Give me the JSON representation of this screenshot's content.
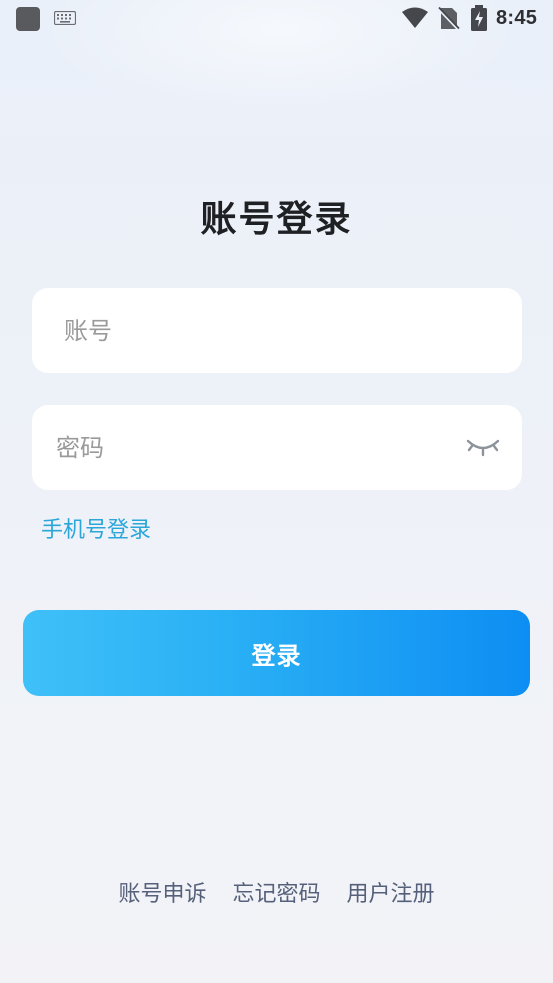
{
  "status_bar": {
    "time": "8:45",
    "icons": [
      "app-icon",
      "keyboard-icon",
      "wifi-icon",
      "no-sim-icon",
      "battery-charging-icon"
    ]
  },
  "page": {
    "title": "账号登录"
  },
  "form": {
    "account_placeholder": "账号",
    "account_value": "",
    "password_placeholder": "密码",
    "password_value": "",
    "password_toggle_icon": "eye-closed-icon"
  },
  "links": {
    "phone_login": "手机号登录"
  },
  "login_button": {
    "label": "登录",
    "gradient_start": "#3fc0f8",
    "gradient_end": "#0d8ef3"
  },
  "footer": {
    "appeal": "账号申诉",
    "forgot_password": "忘记密码",
    "register": "用户注册"
  },
  "colors": {
    "link": "#2ba6d9",
    "footer_text": "#55607a",
    "title": "#1f2023"
  }
}
